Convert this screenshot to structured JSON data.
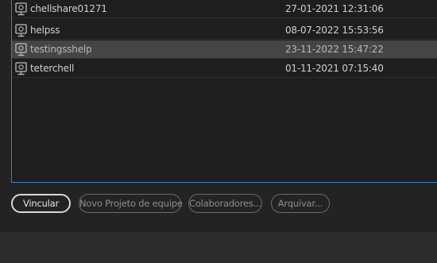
{
  "colors": {
    "accent_border": "#3d7fc4",
    "selected_row": "#454545",
    "text": "#d0d0d0",
    "button_disabled_text": "#8e8e8e"
  },
  "projects": [
    {
      "name": "chellshare01271",
      "date": "27-01-2021 12:31:06",
      "icon": "team-project-icon",
      "selected": false
    },
    {
      "name": "helpss",
      "date": "08-07-2022 15:53:56",
      "icon": "team-project-icon",
      "selected": false
    },
    {
      "name": "testingsshelp",
      "date": "23-11-2022 15:47:22",
      "icon": "team-project-icon",
      "selected": true
    },
    {
      "name": "teterchell",
      "date": "01-11-2021 07:15:40",
      "icon": "team-project-icon",
      "selected": false
    }
  ],
  "buttons": {
    "link": "Vincular",
    "new_team_project": "Novo Projeto de equipe",
    "collaborators": "Colaboradores...",
    "archive": "Arquivar..."
  }
}
